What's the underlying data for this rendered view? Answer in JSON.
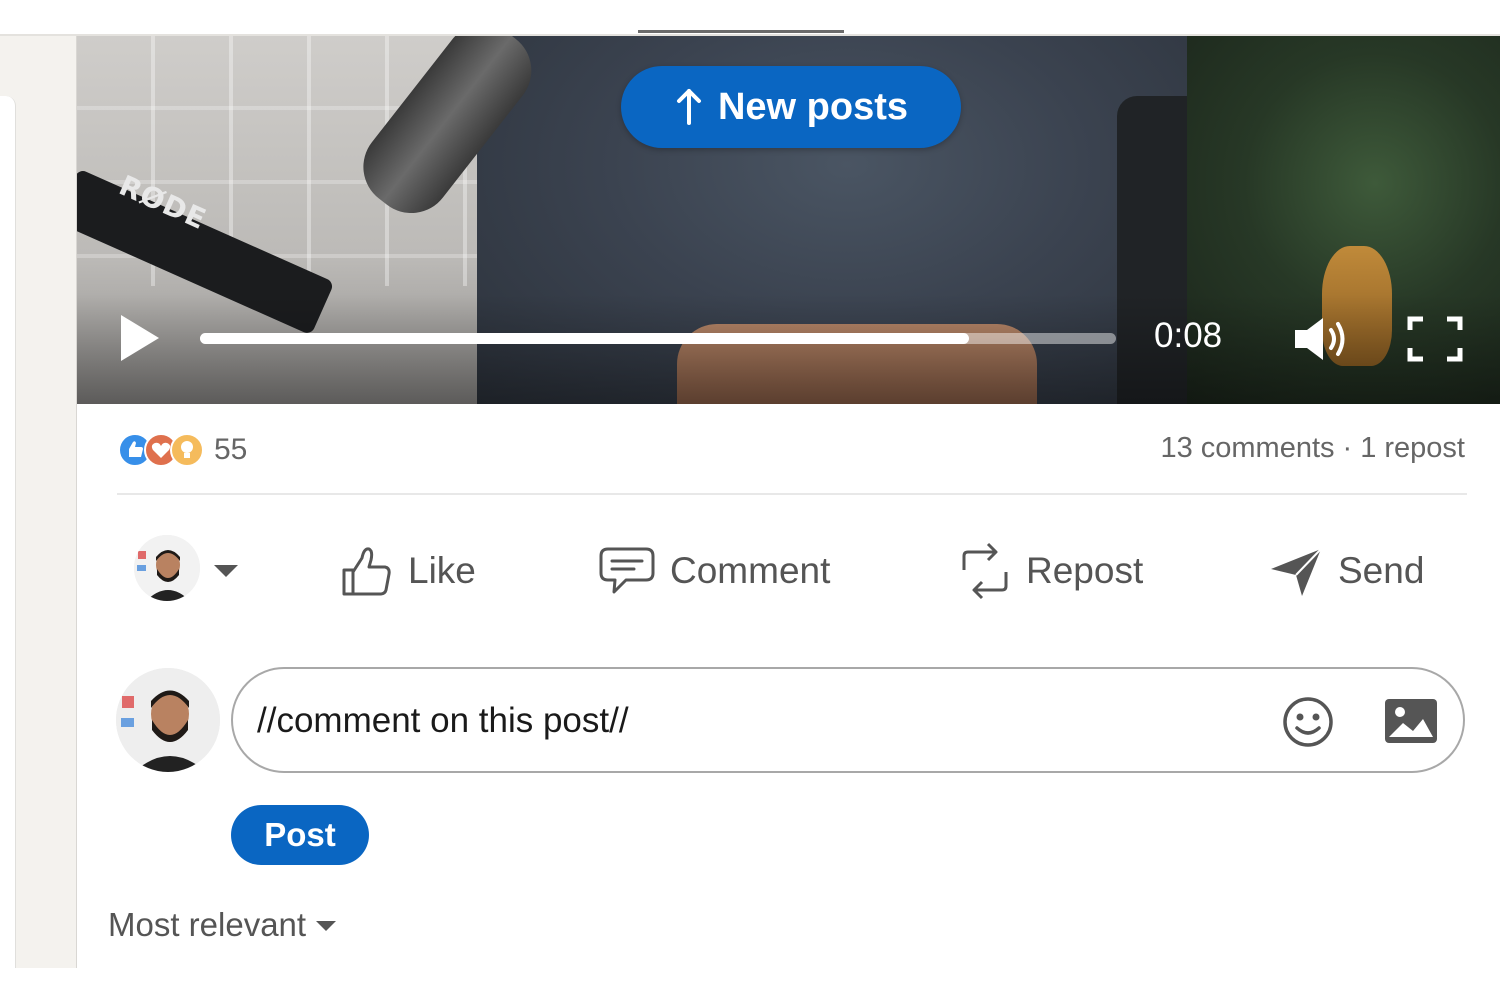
{
  "feed": {
    "new_posts_label": "New posts"
  },
  "video": {
    "brand_text": "RØDE",
    "current_time": "0:08",
    "progress_fraction": 0.84,
    "state": "paused"
  },
  "social": {
    "reaction_count": "55",
    "comments_text": "13 comments",
    "separator": "·",
    "reposts_text": "1 repost",
    "reaction_icons": [
      "like-icon",
      "love-icon",
      "insightful-icon"
    ]
  },
  "actions": {
    "like_label": "Like",
    "comment_label": "Comment",
    "repost_label": "Repost",
    "send_label": "Send"
  },
  "comment_composer": {
    "value": "//comment on this post//",
    "post_label": "Post"
  },
  "comments": {
    "sort_label": "Most relevant"
  },
  "colors": {
    "accent": "#0a66c2",
    "muted_text": "#666666",
    "reaction_like": "#378fe9",
    "reaction_love": "#df704d",
    "reaction_insight": "#f5bb5c"
  }
}
